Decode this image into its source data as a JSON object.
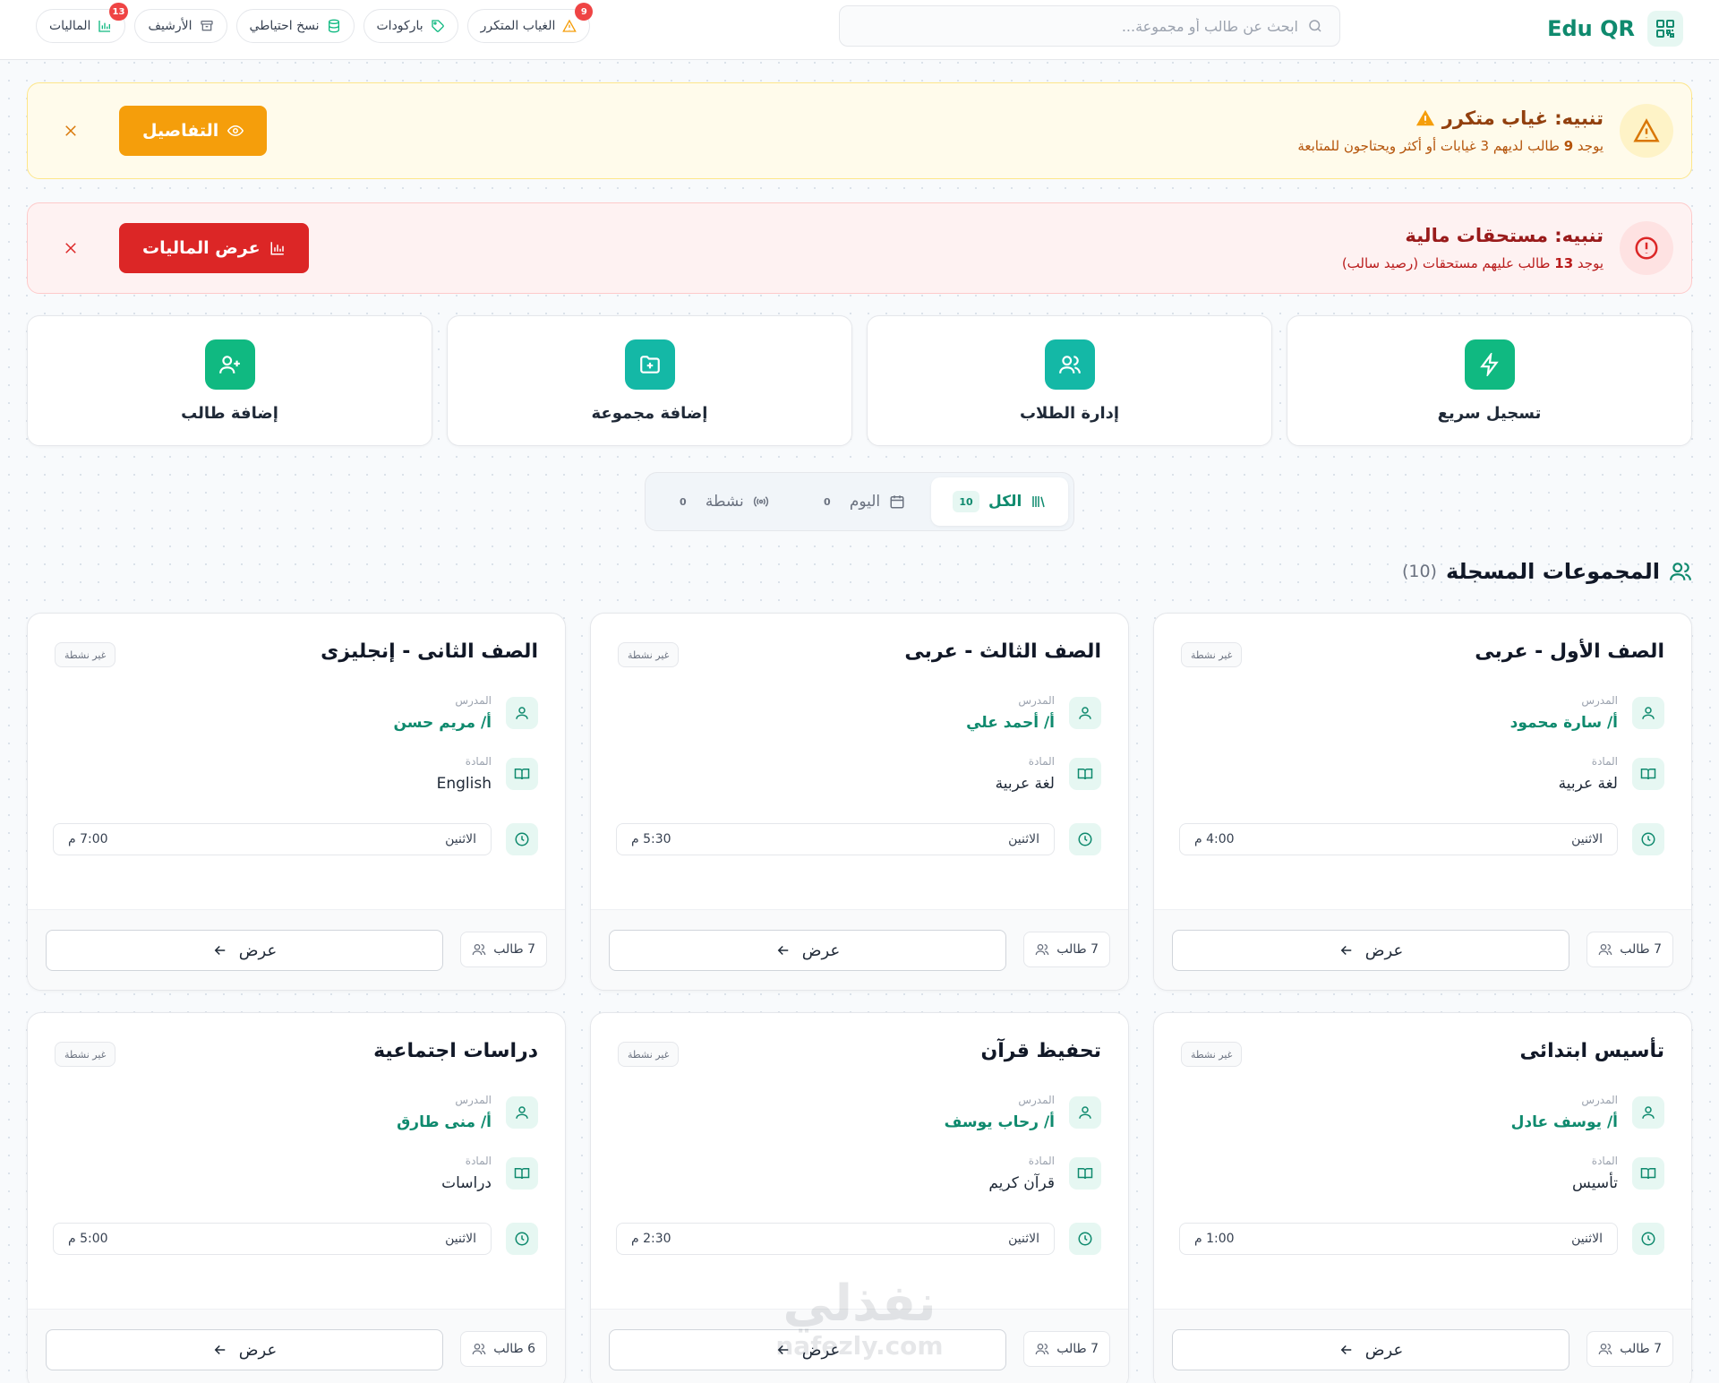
{
  "header": {
    "brand": "Edu QR",
    "search_placeholder": "ابحث عن طالب أو مجموعة...",
    "nav": [
      {
        "label": "الغياب المتكرر",
        "badge": "9",
        "icon": "alert-triangle-icon"
      },
      {
        "label": "باركودات",
        "badge": "",
        "icon": "tag-icon"
      },
      {
        "label": "نسخ احتياطي",
        "badge": "",
        "icon": "database-icon"
      },
      {
        "label": "الأرشيف",
        "badge": "",
        "icon": "archive-icon"
      },
      {
        "label": "الماليات",
        "badge": "13",
        "icon": "bar-chart-icon"
      }
    ]
  },
  "alerts": {
    "absence": {
      "title": "تنبيه: غياب متكرر",
      "desc_prefix": "يوجد",
      "count": "9",
      "desc_suffix": "طالب لديهم 3 غيابات أو أكثر ويحتاجون للمتابعة",
      "button": "التفاصيل",
      "color": "#f59e0b"
    },
    "finance": {
      "title": "تنبيه: مستحقات مالية",
      "desc_prefix": "يوجد",
      "count": "13",
      "desc_suffix": "طالب عليهم مستحقات (رصيد سالب)",
      "button": "عرض الماليات",
      "color": "#dc2626"
    }
  },
  "actions": [
    {
      "label": "تسجيل سريع",
      "icon": "zap-icon",
      "color": "#10b981"
    },
    {
      "label": "إدارة الطلاب",
      "icon": "users-icon",
      "color": "#14b8a6"
    },
    {
      "label": "إضافة مجموعة",
      "icon": "folder-plus-icon",
      "color": "#14b8a6"
    },
    {
      "label": "إضافة طالب",
      "icon": "user-plus-icon",
      "color": "#10b981"
    }
  ],
  "filters": [
    {
      "label": "الكل",
      "count": "10",
      "active": true
    },
    {
      "label": "اليوم",
      "count": "0",
      "active": false
    },
    {
      "label": "نشطة",
      "count": "0",
      "active": false
    }
  ],
  "section": {
    "title": "المجموعات المسجلة",
    "count": "(10)"
  },
  "labels": {
    "teacher": "المدرس",
    "subject": "المادة",
    "view": "عرض"
  },
  "groups": [
    {
      "name": "الصف الأول - عربى",
      "status": "غير نشطة",
      "teacher": "أ/ سارة محمود",
      "subject": "لغة عربية",
      "day": "الاثنين",
      "time": "4:00 م",
      "students": "7 طالب"
    },
    {
      "name": "الصف الثالث - عربى",
      "status": "غير نشطة",
      "teacher": "أ/ أحمد علي",
      "subject": "لغة عربية",
      "day": "الاثنين",
      "time": "5:30 م",
      "students": "7 طالب"
    },
    {
      "name": "الصف الثانى - إنجليزى",
      "status": "غير نشطة",
      "teacher": "أ/ مريم حسن",
      "subject": "English",
      "day": "الاثنين",
      "time": "7:00 م",
      "students": "7 طالب"
    },
    {
      "name": "تأسيس ابتدائى",
      "status": "غير نشطة",
      "teacher": "أ/ يوسف عادل",
      "subject": "تأسيس",
      "day": "الاثنين",
      "time": "1:00 م",
      "students": "7 طالب"
    },
    {
      "name": "تحفيظ قرآن",
      "status": "غير نشطة",
      "teacher": "أ/ رحاب يوسف",
      "subject": "قرآن كريم",
      "day": "الاثنين",
      "time": "2:30 م",
      "students": "7 طالب"
    },
    {
      "name": "دراسات اجتماعية",
      "status": "غير نشطة",
      "teacher": "أ/ منى طارق",
      "subject": "دراسات",
      "day": "الاثنين",
      "time": "5:00 م",
      "students": "6 طالب"
    }
  ],
  "watermark": {
    "arabic": "نفذلي",
    "latin": "nafezly.com"
  }
}
